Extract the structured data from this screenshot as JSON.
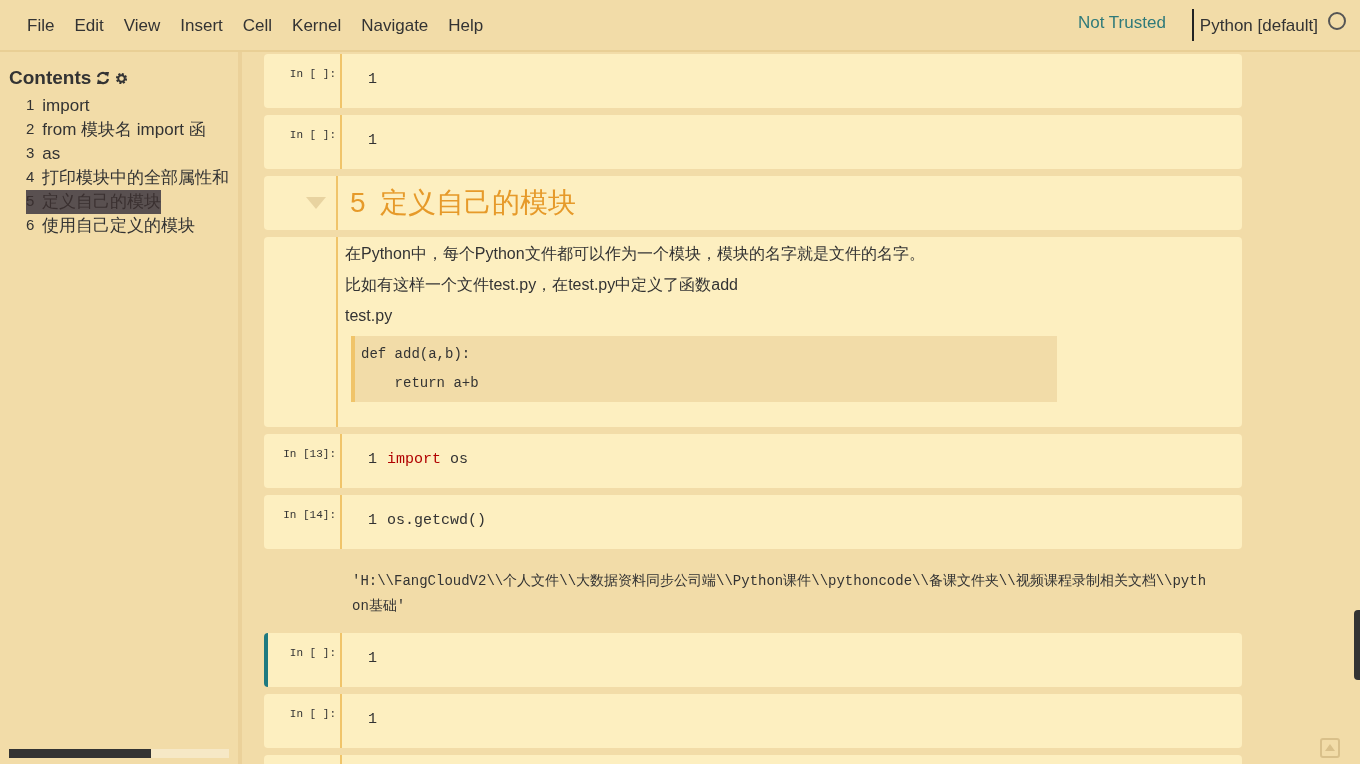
{
  "menu": [
    "File",
    "Edit",
    "View",
    "Insert",
    "Cell",
    "Kernel",
    "Navigate",
    "Help"
  ],
  "trust": "Not Trusted",
  "kernel": {
    "name": "Python [default]",
    "busy": false
  },
  "toc": {
    "title": "Contents",
    "items": [
      {
        "number": "1",
        "text": "import",
        "selected": false
      },
      {
        "number": "2",
        "text": "from 模块名 import 函",
        "selected": false
      },
      {
        "number": "3",
        "text": "as",
        "selected": false
      },
      {
        "number": "4",
        "text": "打印模块中的全部属性和",
        "selected": false
      },
      {
        "number": "5",
        "text": "定义自己的模块",
        "selected": true
      },
      {
        "number": "6",
        "text": "使用自己定义的模块",
        "selected": false
      }
    ]
  },
  "cells": [
    {
      "kind": "code",
      "prompt": "In [ ]:",
      "selected": false,
      "lines": [
        {
          "number": "1"
        }
      ]
    },
    {
      "kind": "code",
      "prompt": "In [ ]:",
      "selected": false,
      "lines": [
        {
          "number": "1"
        }
      ]
    },
    {
      "kind": "heading",
      "number": "5",
      "text": "定义自己的模块",
      "expanded": true
    },
    {
      "kind": "markdown",
      "paragraphs": [
        "在Python中，每个Python文件都可以作为一个模块，模块的名字就是文件的名字。",
        "比如有这样一个文件test.py，在test.py中定义了函数add",
        "test.py"
      ],
      "code": [
        "def add(a,b):",
        "    return a+b"
      ]
    },
    {
      "kind": "code",
      "prompt": "In [13]:",
      "selected": false,
      "lines": [
        {
          "number": "1",
          "tokens": [
            {
              "text": "import",
              "kind": "keyword"
            },
            {
              "text": " os",
              "kind": "plain"
            }
          ]
        }
      ]
    },
    {
      "kind": "code",
      "prompt": "In [14]:",
      "selected": false,
      "lines": [
        {
          "number": "1",
          "tokens": [
            {
              "text": "os.getcwd()",
              "kind": "plain"
            }
          ]
        }
      ]
    },
    {
      "kind": "output",
      "text": "'H:\\\\FangCloudV2\\\\个人文件\\\\大数据资料同步公司端\\\\Python课件\\\\pythoncode\\\\备课文件夹\\\\视频课程录制相关文档\\\\python基础'"
    },
    {
      "kind": "code",
      "prompt": "In [ ]:",
      "selected": true,
      "lines": [
        {
          "number": "1"
        }
      ]
    },
    {
      "kind": "code",
      "prompt": "In [ ]:",
      "selected": false,
      "lines": [
        {
          "number": "1"
        }
      ]
    },
    {
      "kind": "partial"
    }
  ]
}
